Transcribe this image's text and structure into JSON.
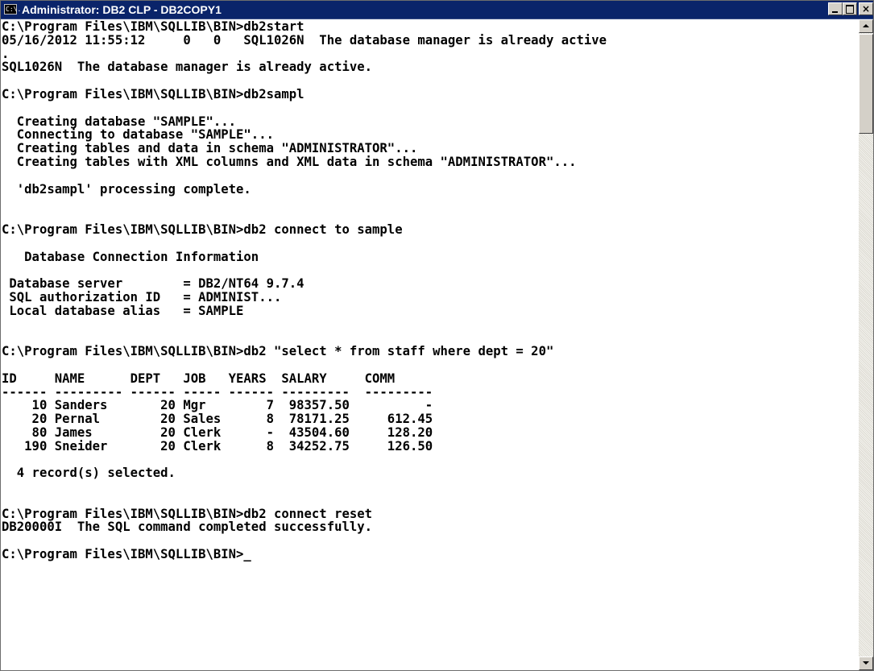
{
  "window": {
    "title": "Administrator: DB2 CLP - DB2COPY1",
    "icon_label": "C:\\.",
    "controls": {
      "minimize": "minimize-icon",
      "maximize": "maximize-icon",
      "close_label": "×"
    }
  },
  "console": {
    "lines": [
      "C:\\Program Files\\IBM\\SQLLIB\\BIN>db2start",
      "05/16/2012 11:55:12     0   0   SQL1026N  The database manager is already active",
      ".",
      "SQL1026N  The database manager is already active.",
      "",
      "C:\\Program Files\\IBM\\SQLLIB\\BIN>db2sampl",
      "",
      "  Creating database \"SAMPLE\"...",
      "  Connecting to database \"SAMPLE\"...",
      "  Creating tables and data in schema \"ADMINISTRATOR\"...",
      "  Creating tables with XML columns and XML data in schema \"ADMINISTRATOR\"...",
      "",
      "  'db2sampl' processing complete.",
      "",
      "",
      "C:\\Program Files\\IBM\\SQLLIB\\BIN>db2 connect to sample",
      "",
      "   Database Connection Information",
      "",
      " Database server        = DB2/NT64 9.7.4",
      " SQL authorization ID   = ADMINIST...",
      " Local database alias   = SAMPLE",
      "",
      "",
      "C:\\Program Files\\IBM\\SQLLIB\\BIN>db2 \"select * from staff where dept = 20\"",
      "",
      "ID     NAME      DEPT   JOB   YEARS  SALARY     COMM",
      "------ --------- ------ ----- ------ ---------  ---------",
      "    10 Sanders       20 Mgr        7  98357.50          -",
      "    20 Pernal        20 Sales      8  78171.25     612.45",
      "    80 James         20 Clerk      -  43504.60     128.20",
      "   190 Sneider       20 Clerk      8  34252.75     126.50",
      "",
      "  4 record(s) selected.",
      "",
      "",
      "C:\\Program Files\\IBM\\SQLLIB\\BIN>db2 connect reset",
      "DB20000I  The SQL command completed successfully.",
      "",
      "C:\\Program Files\\IBM\\SQLLIB\\BIN>_"
    ]
  },
  "colors": {
    "titlebar": "#0a246a",
    "console_background": "#ffffff",
    "console_text": "#000000",
    "chrome": "#d4d0c8"
  }
}
